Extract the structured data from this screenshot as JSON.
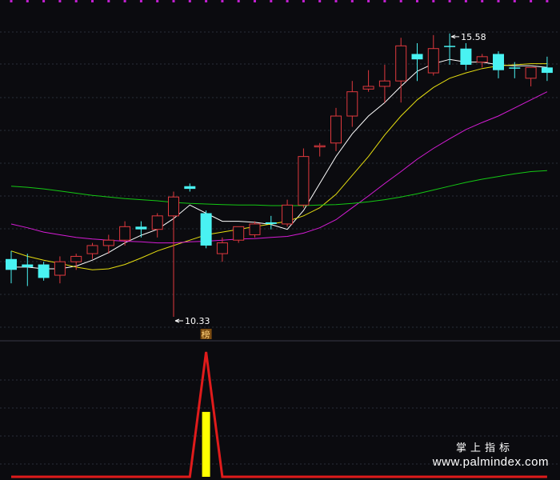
{
  "chart_data": [
    {
      "type": "candlestick",
      "panel": "price",
      "ylim": [
        9.9,
        16.2
      ],
      "candles": [
        {
          "o": 11.4,
          "h": 11.55,
          "l": 10.95,
          "c": 11.2,
          "color": "#49f2f2"
        },
        {
          "o": 11.3,
          "h": 11.5,
          "l": 10.9,
          "c": 11.25,
          "color": "#49f2f2"
        },
        {
          "o": 11.3,
          "h": 11.35,
          "l": 11.0,
          "c": 11.05,
          "color": "#49f2f2"
        },
        {
          "o": 11.1,
          "h": 11.45,
          "l": 10.95,
          "c": 11.35,
          "color": "#e0393e"
        },
        {
          "o": 11.35,
          "h": 11.5,
          "l": 11.2,
          "c": 11.45,
          "color": "#e0393e"
        },
        {
          "o": 11.5,
          "h": 11.7,
          "l": 11.4,
          "c": 11.65,
          "color": "#e0393e"
        },
        {
          "o": 11.65,
          "h": 11.85,
          "l": 11.5,
          "c": 11.75,
          "color": "#e0393e"
        },
        {
          "o": 11.75,
          "h": 12.1,
          "l": 11.65,
          "c": 12.0,
          "color": "#e0393e"
        },
        {
          "o": 12.0,
          "h": 12.1,
          "l": 11.8,
          "c": 11.95,
          "color": "#49f2f2"
        },
        {
          "o": 11.95,
          "h": 12.25,
          "l": 11.8,
          "c": 12.2,
          "color": "#e0393e"
        },
        {
          "o": 12.2,
          "h": 12.65,
          "l": 10.33,
          "c": 12.55,
          "color": "#e0393e"
        },
        {
          "o": 12.75,
          "h": 12.8,
          "l": 12.65,
          "c": 12.7,
          "color": "#49f2f2"
        },
        {
          "o": 12.25,
          "h": 12.3,
          "l": 11.6,
          "c": 11.65,
          "color": "#49f2f2"
        },
        {
          "o": 11.5,
          "h": 11.8,
          "l": 11.35,
          "c": 11.7,
          "color": "#e0393e"
        },
        {
          "o": 11.75,
          "h": 12.0,
          "l": 11.7,
          "c": 12.0,
          "color": "#e0393e"
        },
        {
          "o": 11.85,
          "h": 12.1,
          "l": 11.8,
          "c": 12.05,
          "color": "#e0393e"
        },
        {
          "o": 12.05,
          "h": 12.2,
          "l": 11.95,
          "c": 12.08,
          "color": "#49f2f2"
        },
        {
          "o": 12.05,
          "h": 12.5,
          "l": 12.0,
          "c": 12.4,
          "color": "#e0393e"
        },
        {
          "o": 12.4,
          "h": 13.45,
          "l": 12.35,
          "c": 13.3,
          "color": "#e0393e"
        },
        {
          "o": 13.5,
          "h": 13.55,
          "l": 13.3,
          "c": 13.5,
          "color": "#e0393e"
        },
        {
          "o": 13.55,
          "h": 14.2,
          "l": 13.4,
          "c": 14.05,
          "color": "#e0393e"
        },
        {
          "o": 14.05,
          "h": 14.7,
          "l": 13.85,
          "c": 14.5,
          "color": "#e0393e"
        },
        {
          "o": 14.55,
          "h": 14.9,
          "l": 14.5,
          "c": 14.6,
          "color": "#e0393e"
        },
        {
          "o": 14.6,
          "h": 15.0,
          "l": 14.3,
          "c": 14.7,
          "color": "#e0393e"
        },
        {
          "o": 14.7,
          "h": 15.5,
          "l": 14.3,
          "c": 15.35,
          "color": "#e0393e"
        },
        {
          "o": 15.2,
          "h": 15.4,
          "l": 14.7,
          "c": 15.1,
          "color": "#49f2f2"
        },
        {
          "o": 14.85,
          "h": 15.55,
          "l": 14.8,
          "c": 15.3,
          "color": "#e0393e"
        },
        {
          "o": 15.35,
          "h": 15.58,
          "l": 15.0,
          "c": 15.35,
          "color": "#49f2f2"
        },
        {
          "o": 15.3,
          "h": 15.4,
          "l": 14.9,
          "c": 15.0,
          "color": "#49f2f2"
        },
        {
          "o": 15.05,
          "h": 15.2,
          "l": 14.95,
          "c": 15.15,
          "color": "#e0393e"
        },
        {
          "o": 15.2,
          "h": 15.25,
          "l": 14.75,
          "c": 14.9,
          "color": "#49f2f2"
        },
        {
          "o": 14.95,
          "h": 15.05,
          "l": 14.75,
          "c": 14.95,
          "color": "#49f2f2"
        },
        {
          "o": 14.75,
          "h": 14.95,
          "l": 14.6,
          "c": 14.95,
          "color": "#e0393e"
        },
        {
          "o": 14.95,
          "h": 15.15,
          "l": 14.7,
          "c": 14.85,
          "color": "#49f2f2"
        }
      ],
      "moving_averages": [
        {
          "color": "#ffffff",
          "values": [
            11.25,
            11.25,
            11.22,
            11.22,
            11.27,
            11.38,
            11.52,
            11.7,
            11.84,
            11.95,
            12.15,
            12.4,
            12.25,
            12.1,
            12.1,
            12.08,
            12.04,
            11.95,
            12.3,
            12.8,
            13.3,
            13.72,
            14.05,
            14.3,
            14.6,
            14.88,
            15.02,
            15.1,
            15.05,
            15.05,
            15.0,
            14.98,
            14.98,
            14.95
          ]
        },
        {
          "color": "#e6de10",
          "values": [
            11.55,
            11.45,
            11.38,
            11.32,
            11.25,
            11.2,
            11.22,
            11.3,
            11.42,
            11.55,
            11.65,
            11.75,
            11.85,
            11.9,
            11.95,
            12.0,
            12.05,
            12.1,
            12.2,
            12.35,
            12.6,
            12.95,
            13.3,
            13.7,
            14.05,
            14.35,
            14.58,
            14.75,
            14.85,
            14.93,
            14.98,
            15.0,
            15.02,
            15.02
          ]
        },
        {
          "color": "#d51cd5",
          "values": [
            12.05,
            11.98,
            11.9,
            11.85,
            11.8,
            11.77,
            11.75,
            11.73,
            11.72,
            11.7,
            11.7,
            11.72,
            11.73,
            11.75,
            11.77,
            11.78,
            11.8,
            11.82,
            11.88,
            11.98,
            12.13,
            12.35,
            12.57,
            12.8,
            13.02,
            13.25,
            13.45,
            13.63,
            13.8,
            13.93,
            14.05,
            14.2,
            14.35,
            14.5
          ]
        },
        {
          "color": "#14c814",
          "values": [
            12.75,
            12.73,
            12.7,
            12.66,
            12.62,
            12.58,
            12.55,
            12.52,
            12.5,
            12.48,
            12.45,
            12.43,
            12.42,
            12.41,
            12.4,
            12.4,
            12.39,
            12.39,
            12.39,
            12.4,
            12.41,
            12.43,
            12.46,
            12.5,
            12.55,
            12.61,
            12.68,
            12.75,
            12.82,
            12.88,
            12.93,
            12.98,
            13.02,
            13.04
          ]
        }
      ],
      "annotations": [
        {
          "text": "15.58",
          "candle": 27,
          "value": 15.58
        },
        {
          "text": "10.33",
          "candle": 10,
          "value": 10.33
        },
        {
          "text": "榜",
          "candle": 12
        }
      ]
    },
    {
      "type": "line",
      "panel": "indicator",
      "ylim": [
        0,
        100
      ],
      "series": [
        {
          "color": "#e01b1b",
          "values": [
            0,
            0,
            0,
            0,
            0,
            0,
            0,
            0,
            0,
            0,
            0,
            0,
            100,
            0,
            0,
            0,
            0,
            0,
            0,
            0,
            0,
            0,
            0,
            0,
            0,
            0,
            0,
            0,
            0,
            0,
            0,
            0,
            0,
            0
          ]
        }
      ],
      "bars": [
        {
          "color": "#ffff00",
          "candle": 12,
          "value": 52
        }
      ]
    }
  ],
  "watermark": {
    "line1": "掌上指标",
    "line2": "www.palmindex.com"
  },
  "colors": {
    "top_markers": "#c020d0",
    "grid": "#2a2f3a",
    "divider": "#3a3a44"
  }
}
